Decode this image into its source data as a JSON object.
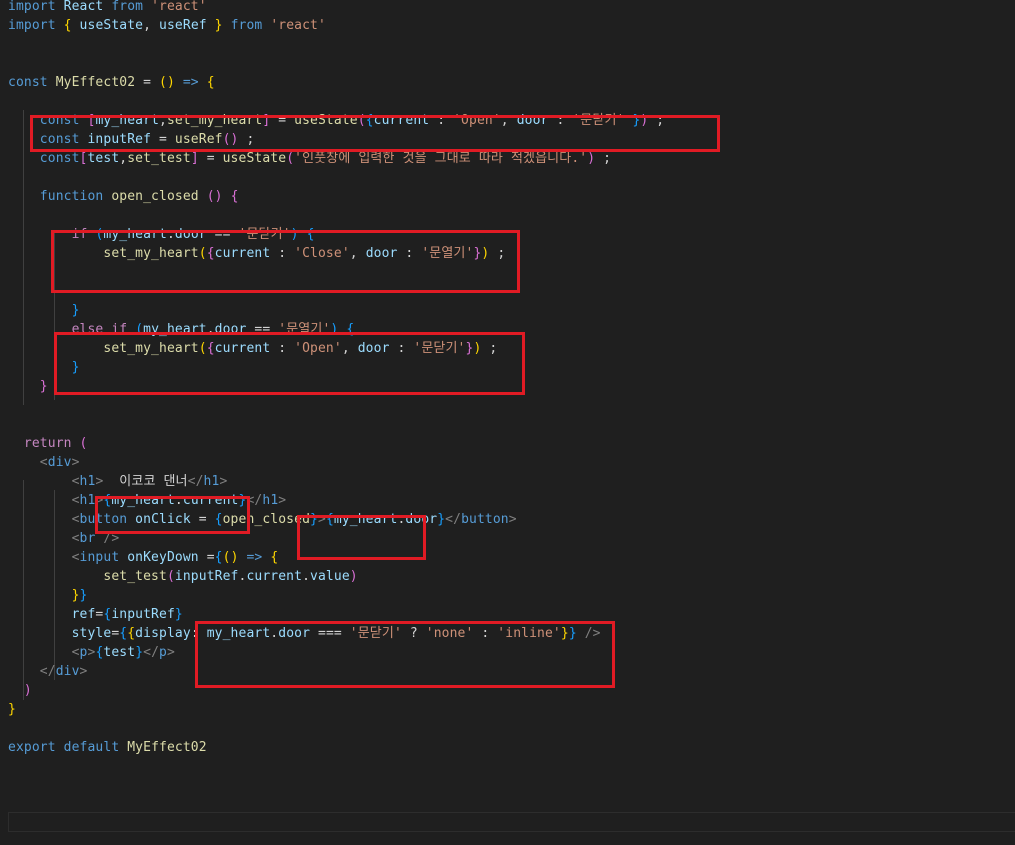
{
  "editor": {
    "language": "javascript",
    "background": "#1f1f1f",
    "annotation_color": "#e01b24",
    "lines": [
      {
        "n": 0,
        "tokens": [
          [
            "kw",
            "import"
          ],
          [
            "txt",
            " "
          ],
          [
            "var",
            "React"
          ],
          [
            "txt",
            " "
          ],
          [
            "kw",
            "from"
          ],
          [
            "txt",
            " "
          ],
          [
            "str",
            "'react'"
          ]
        ]
      },
      {
        "n": 1,
        "tokens": [
          [
            "kw",
            "import"
          ],
          [
            "txt",
            " "
          ],
          [
            "b1",
            "{"
          ],
          [
            "txt",
            " "
          ],
          [
            "var",
            "useState"
          ],
          [
            "txt",
            ", "
          ],
          [
            "var",
            "useRef"
          ],
          [
            "txt",
            " "
          ],
          [
            "b1",
            "}"
          ],
          [
            "txt",
            " "
          ],
          [
            "kw",
            "from"
          ],
          [
            "txt",
            " "
          ],
          [
            "str",
            "'react'"
          ]
        ]
      },
      {
        "n": 4,
        "tokens": [
          [
            "kw",
            "const"
          ],
          [
            "txt",
            " "
          ],
          [
            "fn",
            "MyEffect02"
          ],
          [
            "txt",
            " = "
          ],
          [
            "b1",
            "("
          ],
          [
            "b1",
            ")"
          ],
          [
            "txt",
            " "
          ],
          [
            "kw",
            "=>"
          ],
          [
            "txt",
            " "
          ],
          [
            "b1",
            "{"
          ]
        ]
      },
      {
        "n": 6,
        "tokens": [
          [
            "txt",
            "    "
          ],
          [
            "kw",
            "const"
          ],
          [
            "txt",
            " "
          ],
          [
            "b2",
            "["
          ],
          [
            "var",
            "my_heart"
          ],
          [
            "txt",
            ","
          ],
          [
            "fn",
            "set_my_heart"
          ],
          [
            "b2",
            "]"
          ],
          [
            "txt",
            " = "
          ],
          [
            "fn",
            "useState"
          ],
          [
            "b2",
            "("
          ],
          [
            "b3",
            "{"
          ],
          [
            "var",
            "current"
          ],
          [
            "txt",
            " : "
          ],
          [
            "str",
            "'Open'"
          ],
          [
            "txt",
            ", "
          ],
          [
            "var",
            "door"
          ],
          [
            "txt",
            " : "
          ],
          [
            "str",
            "'문닫기'"
          ],
          [
            "txt",
            " "
          ],
          [
            "b3",
            "}"
          ],
          [
            "b2",
            ")"
          ],
          [
            "txt",
            " ;"
          ]
        ]
      },
      {
        "n": 7,
        "tokens": [
          [
            "txt",
            "    "
          ],
          [
            "kw",
            "const"
          ],
          [
            "txt",
            " "
          ],
          [
            "var",
            "inputRef"
          ],
          [
            "txt",
            " = "
          ],
          [
            "fn",
            "useRef"
          ],
          [
            "b2",
            "("
          ],
          [
            "b2",
            ")"
          ],
          [
            "txt",
            " ;"
          ]
        ]
      },
      {
        "n": 8,
        "tokens": [
          [
            "txt",
            "    "
          ],
          [
            "kw",
            "const"
          ],
          [
            "b2",
            "["
          ],
          [
            "var",
            "test"
          ],
          [
            "txt",
            ","
          ],
          [
            "fn",
            "set_test"
          ],
          [
            "b2",
            "]"
          ],
          [
            "txt",
            " = "
          ],
          [
            "fn",
            "useState"
          ],
          [
            "b2",
            "("
          ],
          [
            "str",
            "'인풋창에 입력한 것을 그대로 따라 적겠읍니다.'"
          ],
          [
            "b2",
            ")"
          ],
          [
            "txt",
            " ;"
          ]
        ]
      },
      {
        "n": 10,
        "tokens": [
          [
            "txt",
            "    "
          ],
          [
            "kw",
            "function"
          ],
          [
            "txt",
            " "
          ],
          [
            "fn",
            "open_closed"
          ],
          [
            "txt",
            " "
          ],
          [
            "b2",
            "("
          ],
          [
            "b2",
            ")"
          ],
          [
            "txt",
            " "
          ],
          [
            "b2",
            "{"
          ]
        ]
      },
      {
        "n": 12,
        "tokens": [
          [
            "txt",
            "        "
          ],
          [
            "ctrl",
            "if"
          ],
          [
            "txt",
            " "
          ],
          [
            "b3",
            "("
          ],
          [
            "var",
            "my_heart"
          ],
          [
            "txt",
            "."
          ],
          [
            "var",
            "door"
          ],
          [
            "txt",
            " == "
          ],
          [
            "str",
            "'문닫기'"
          ],
          [
            "b3",
            ")"
          ],
          [
            "txt",
            " "
          ],
          [
            "b3",
            "{"
          ]
        ]
      },
      {
        "n": 13,
        "tokens": [
          [
            "txt",
            "            "
          ],
          [
            "fn",
            "set_my_heart"
          ],
          [
            "b1",
            "("
          ],
          [
            "b2",
            "{"
          ],
          [
            "var",
            "current"
          ],
          [
            "txt",
            " : "
          ],
          [
            "str",
            "'Close'"
          ],
          [
            "txt",
            ", "
          ],
          [
            "var",
            "door"
          ],
          [
            "txt",
            " : "
          ],
          [
            "str",
            "'문열기'"
          ],
          [
            "b2",
            "}"
          ],
          [
            "b1",
            ")"
          ],
          [
            "txt",
            " ;"
          ]
        ]
      },
      {
        "n": 16,
        "tokens": [
          [
            "txt",
            "        "
          ],
          [
            "b3",
            "}"
          ]
        ]
      },
      {
        "n": 17,
        "tokens": [
          [
            "txt",
            "        "
          ],
          [
            "ctrl",
            "else"
          ],
          [
            "txt",
            " "
          ],
          [
            "ctrl",
            "if"
          ],
          [
            "txt",
            " "
          ],
          [
            "b3",
            "("
          ],
          [
            "var",
            "my_heart"
          ],
          [
            "txt",
            "."
          ],
          [
            "var",
            "door"
          ],
          [
            "txt",
            " == "
          ],
          [
            "str",
            "'문열기'"
          ],
          [
            "b3",
            ")"
          ],
          [
            "txt",
            " "
          ],
          [
            "b3",
            "{"
          ]
        ]
      },
      {
        "n": 18,
        "tokens": [
          [
            "txt",
            "            "
          ],
          [
            "fn",
            "set_my_heart"
          ],
          [
            "b1",
            "("
          ],
          [
            "b2",
            "{"
          ],
          [
            "var",
            "current"
          ],
          [
            "txt",
            " : "
          ],
          [
            "str",
            "'Open'"
          ],
          [
            "txt",
            ", "
          ],
          [
            "var",
            "door"
          ],
          [
            "txt",
            " : "
          ],
          [
            "str",
            "'문닫기'"
          ],
          [
            "b2",
            "}"
          ],
          [
            "b1",
            ")"
          ],
          [
            "txt",
            " ;"
          ]
        ]
      },
      {
        "n": 19,
        "tokens": [
          [
            "txt",
            "        "
          ],
          [
            "b3",
            "}"
          ]
        ]
      },
      {
        "n": 20,
        "tokens": [
          [
            "txt",
            "    "
          ],
          [
            "b2",
            "}"
          ]
        ]
      },
      {
        "n": 23,
        "tokens": [
          [
            "txt",
            "  "
          ],
          [
            "ctrl",
            "return"
          ],
          [
            "txt",
            " "
          ],
          [
            "b2",
            "("
          ]
        ]
      },
      {
        "n": 24,
        "tokens": [
          [
            "txt",
            "    "
          ],
          [
            "tag",
            "<"
          ],
          [
            "tagname",
            "div"
          ],
          [
            "tag",
            ">"
          ]
        ]
      },
      {
        "n": 25,
        "tokens": [
          [
            "txt",
            "        "
          ],
          [
            "tag",
            "<"
          ],
          [
            "tagname",
            "h1"
          ],
          [
            "tag",
            ">"
          ],
          [
            "txt",
            "  이코코 댄너"
          ],
          [
            "tag",
            "</"
          ],
          [
            "tagname",
            "h1"
          ],
          [
            "tag",
            ">"
          ]
        ]
      },
      {
        "n": 26,
        "tokens": [
          [
            "txt",
            "        "
          ],
          [
            "tag",
            "<"
          ],
          [
            "tagname",
            "h1"
          ],
          [
            "tag",
            ">"
          ],
          [
            "b3",
            "{"
          ],
          [
            "var",
            "my_heart"
          ],
          [
            "txt",
            "."
          ],
          [
            "var",
            "current"
          ],
          [
            "b3",
            "}"
          ],
          [
            "tag",
            "</"
          ],
          [
            "tagname",
            "h1"
          ],
          [
            "tag",
            ">"
          ]
        ]
      },
      {
        "n": 27,
        "tokens": [
          [
            "txt",
            "        "
          ],
          [
            "tag",
            "<"
          ],
          [
            "tagname",
            "button"
          ],
          [
            "txt",
            " "
          ],
          [
            "var",
            "onClick"
          ],
          [
            "txt",
            " = "
          ],
          [
            "b3",
            "{"
          ],
          [
            "fn",
            "open_closed"
          ],
          [
            "b3",
            "}"
          ],
          [
            "tag",
            ">"
          ],
          [
            "b3",
            "{"
          ],
          [
            "var",
            "my_heart"
          ],
          [
            "txt",
            "."
          ],
          [
            "var",
            "door"
          ],
          [
            "b3",
            "}"
          ],
          [
            "tag",
            "</"
          ],
          [
            "tagname",
            "button"
          ],
          [
            "tag",
            ">"
          ]
        ]
      },
      {
        "n": 28,
        "tokens": [
          [
            "txt",
            "        "
          ],
          [
            "tag",
            "<"
          ],
          [
            "tagname",
            "br"
          ],
          [
            "txt",
            " "
          ],
          [
            "tag",
            "/>"
          ]
        ]
      },
      {
        "n": 29,
        "tokens": [
          [
            "txt",
            "        "
          ],
          [
            "tag",
            "<"
          ],
          [
            "tagname",
            "input"
          ],
          [
            "txt",
            " "
          ],
          [
            "var",
            "onKeyDown"
          ],
          [
            "txt",
            " ="
          ],
          [
            "b3",
            "{"
          ],
          [
            "b1",
            "("
          ],
          [
            "b1",
            ")"
          ],
          [
            "txt",
            " "
          ],
          [
            "kw",
            "=>"
          ],
          [
            "txt",
            " "
          ],
          [
            "b1",
            "{"
          ]
        ]
      },
      {
        "n": 30,
        "tokens": [
          [
            "txt",
            "            "
          ],
          [
            "fn",
            "set_test"
          ],
          [
            "b2",
            "("
          ],
          [
            "var",
            "inputRef"
          ],
          [
            "txt",
            "."
          ],
          [
            "var",
            "current"
          ],
          [
            "txt",
            "."
          ],
          [
            "var",
            "value"
          ],
          [
            "b2",
            ")"
          ]
        ]
      },
      {
        "n": 31,
        "tokens": [
          [
            "txt",
            "        "
          ],
          [
            "b1",
            "}"
          ],
          [
            "b3",
            "}"
          ]
        ]
      },
      {
        "n": 32,
        "tokens": [
          [
            "txt",
            "        "
          ],
          [
            "var",
            "ref"
          ],
          [
            "txt",
            "="
          ],
          [
            "b3",
            "{"
          ],
          [
            "var",
            "inputRef"
          ],
          [
            "b3",
            "}"
          ]
        ]
      },
      {
        "n": 33,
        "tokens": [
          [
            "txt",
            "        "
          ],
          [
            "var",
            "style"
          ],
          [
            "txt",
            "="
          ],
          [
            "b3",
            "{"
          ],
          [
            "b1",
            "{"
          ],
          [
            "var",
            "display"
          ],
          [
            "txt",
            ": "
          ],
          [
            "var",
            "my_heart"
          ],
          [
            "txt",
            "."
          ],
          [
            "var",
            "door"
          ],
          [
            "txt",
            " === "
          ],
          [
            "str",
            "'문닫기'"
          ],
          [
            "txt",
            " ? "
          ],
          [
            "str",
            "'none'"
          ],
          [
            "txt",
            " : "
          ],
          [
            "str",
            "'inline'"
          ],
          [
            "b1",
            "}"
          ],
          [
            "b3",
            "}"
          ],
          [
            "txt",
            " "
          ],
          [
            "tag",
            "/>"
          ]
        ]
      },
      {
        "n": 34,
        "tokens": [
          [
            "txt",
            "        "
          ],
          [
            "tag",
            "<"
          ],
          [
            "tagname",
            "p"
          ],
          [
            "tag",
            ">"
          ],
          [
            "b3",
            "{"
          ],
          [
            "var",
            "test"
          ],
          [
            "b3",
            "}"
          ],
          [
            "tag",
            "</"
          ],
          [
            "tagname",
            "p"
          ],
          [
            "tag",
            ">"
          ]
        ]
      },
      {
        "n": 35,
        "tokens": [
          [
            "txt",
            "    "
          ],
          [
            "tag",
            "</"
          ],
          [
            "tagname",
            "div"
          ],
          [
            "tag",
            ">"
          ]
        ]
      },
      {
        "n": 36,
        "tokens": [
          [
            "txt",
            "  "
          ],
          [
            "b2",
            ")"
          ]
        ]
      },
      {
        "n": 37,
        "tokens": [
          [
            "b1",
            "}"
          ]
        ]
      },
      {
        "n": 39,
        "tokens": [
          [
            "kw",
            "export"
          ],
          [
            "txt",
            " "
          ],
          [
            "kw",
            "default"
          ],
          [
            "txt",
            " "
          ],
          [
            "fn",
            "MyEffect02"
          ]
        ]
      }
    ]
  }
}
